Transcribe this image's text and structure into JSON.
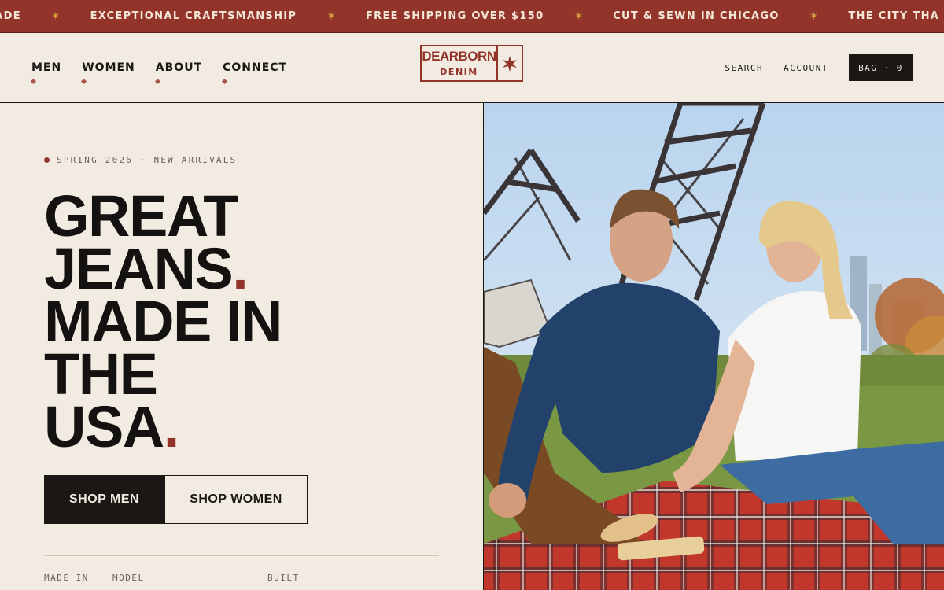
{
  "announcement": {
    "items": [
      "MADE",
      "EXCEPTIONAL CRAFTSMANSHIP",
      "FREE SHIPPING OVER $150",
      "CUT & SEWN IN CHICAGO",
      "THE CITY THA"
    ],
    "separator_icon": "star-icon",
    "star_color": "#d7a441",
    "background": "#93342a"
  },
  "nav": {
    "items": [
      {
        "label": "MEN"
      },
      {
        "label": "WOMEN"
      },
      {
        "label": "ABOUT"
      },
      {
        "label": "CONNECT"
      }
    ]
  },
  "logo": {
    "word1": "DEARBORN",
    "word2": "DENIM",
    "icon": "six-point-star-icon",
    "color": "#93342a"
  },
  "header_right": {
    "search": "SEARCH",
    "account": "ACCOUNT",
    "bag": "BAG · 0"
  },
  "hero": {
    "eyebrow": "SPRING 2026 · NEW ARRIVALS",
    "headline": {
      "line1": "GREAT",
      "line2": "JEANS",
      "line3": "MADE IN",
      "line4": "THE",
      "line5": "USA",
      "period": "."
    },
    "cta_primary": "SHOP MEN",
    "cta_secondary": "SHOP WOMEN",
    "stats_labels": [
      "MADE IN",
      "MODEL",
      "BUILT"
    ],
    "image": "photo-couple-picnic-chicago-bridge"
  },
  "colors": {
    "page_bg": "#f1ebe1",
    "ink": "#1a1714",
    "accent": "#93342a"
  }
}
